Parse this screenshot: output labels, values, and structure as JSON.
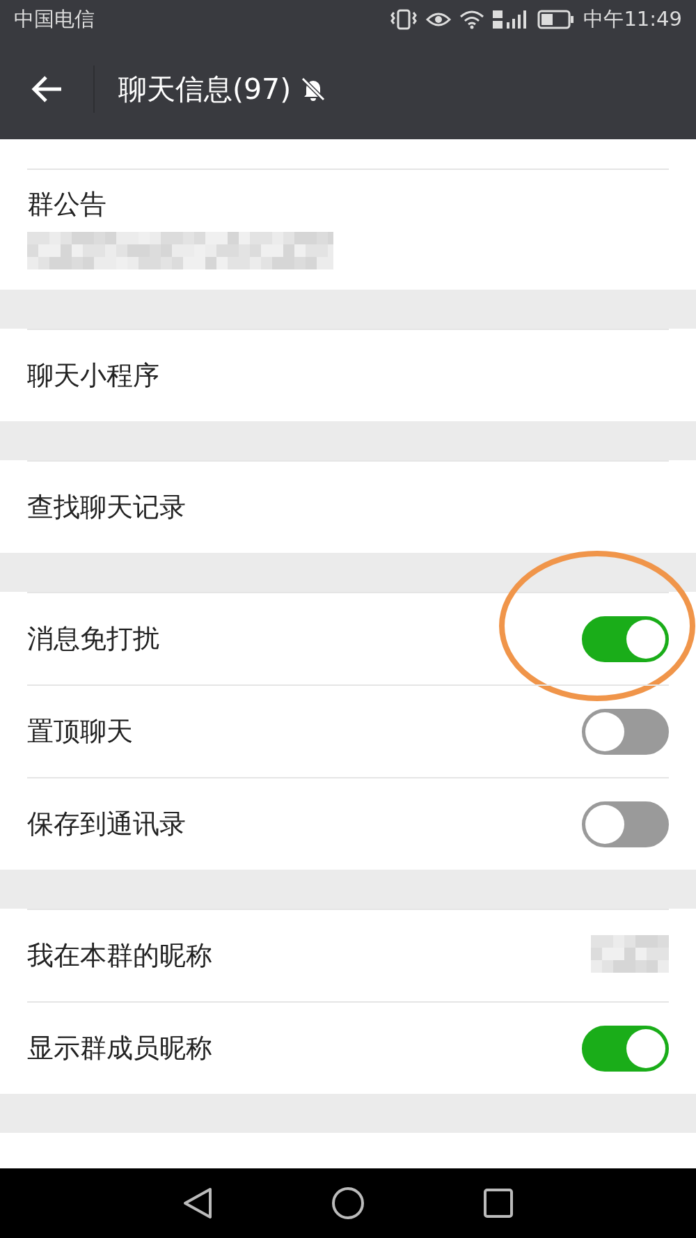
{
  "status_bar": {
    "carrier": "中国电信",
    "time": "中午11:49"
  },
  "header": {
    "title": "聊天信息(97)",
    "muted": true
  },
  "sections": [
    {
      "items": [
        {
          "kind": "notice",
          "label": "群公告"
        }
      ]
    },
    {
      "items": [
        {
          "kind": "link",
          "label": "聊天小程序"
        }
      ]
    },
    {
      "items": [
        {
          "kind": "link",
          "label": "查找聊天记录"
        }
      ]
    },
    {
      "items": [
        {
          "kind": "toggle",
          "label": "消息免打扰",
          "on": true,
          "circled": true
        },
        {
          "kind": "toggle",
          "label": "置顶聊天",
          "on": false,
          "circled": false
        },
        {
          "kind": "toggle",
          "label": "保存到通讯录",
          "on": false,
          "circled": false
        }
      ]
    },
    {
      "items": [
        {
          "kind": "value",
          "label": "我在本群的昵称"
        },
        {
          "kind": "toggle",
          "label": "显示群成员昵称",
          "on": true,
          "circled": false
        }
      ]
    }
  ]
}
